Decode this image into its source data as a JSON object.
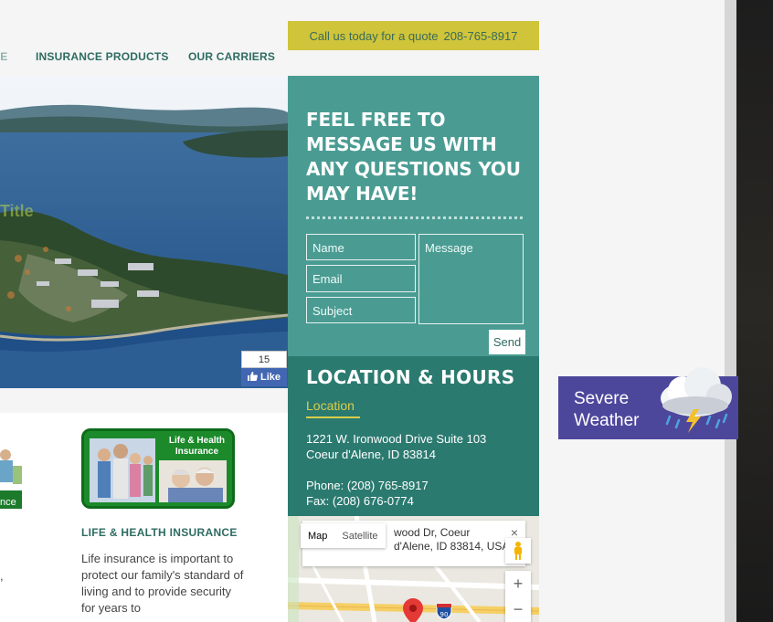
{
  "header": {
    "call_label": "Call us today for a quote",
    "phone": "208-765-8917"
  },
  "nav": {
    "items": [
      "ME",
      "INSURANCE PRODUCTS",
      "OUR CARRIERS"
    ]
  },
  "hero": {
    "overlay_text": "Title",
    "facebook": {
      "count": "15",
      "like_label": "Like"
    }
  },
  "contact_form": {
    "heading": "FEEL FREE TO MESSAGE US WITH ANY QUESTIONS YOU MAY HAVE!",
    "name_placeholder": "Name",
    "email_placeholder": "Email",
    "subject_placeholder": "Subject",
    "message_placeholder": "Message",
    "send_label": "Send"
  },
  "location": {
    "heading": "LOCATION & HOURS",
    "subheading": "Location",
    "address_line1": "1221 W. Ironwood Drive Suite 103",
    "address_line2": "Coeur d'Alene, ID 83814",
    "phone": "Phone: (208) 765-8917",
    "fax": "Fax: (208) 676-0774"
  },
  "map": {
    "tab_map": "Map",
    "tab_satellite": "Satellite",
    "bubble_line1": "wood Dr, Coeur",
    "bubble_line2": "d'Alene, ID 83814, USA",
    "close": "×",
    "zoom_in": "+",
    "zoom_out": "−",
    "highway": "90"
  },
  "products": {
    "life_image_label_line1": "Life & Health",
    "life_image_label_line2": "Insurance",
    "life_title": "LIFE & HEALTH INSURANCE",
    "life_text": "Life insurance is important to protect our family's standard of living and to provide security for years to",
    "left_fragment": "nce",
    "left_text_fragment": ","
  },
  "weather_widget": {
    "line1": "Severe",
    "line2": "Weather",
    "icon": "storm-cloud-icon"
  },
  "colors": {
    "teal_light": "#4a9c93",
    "teal_dark": "#2b7a70",
    "yellow": "#cfc43a",
    "weather_purple": "#4d479c"
  }
}
